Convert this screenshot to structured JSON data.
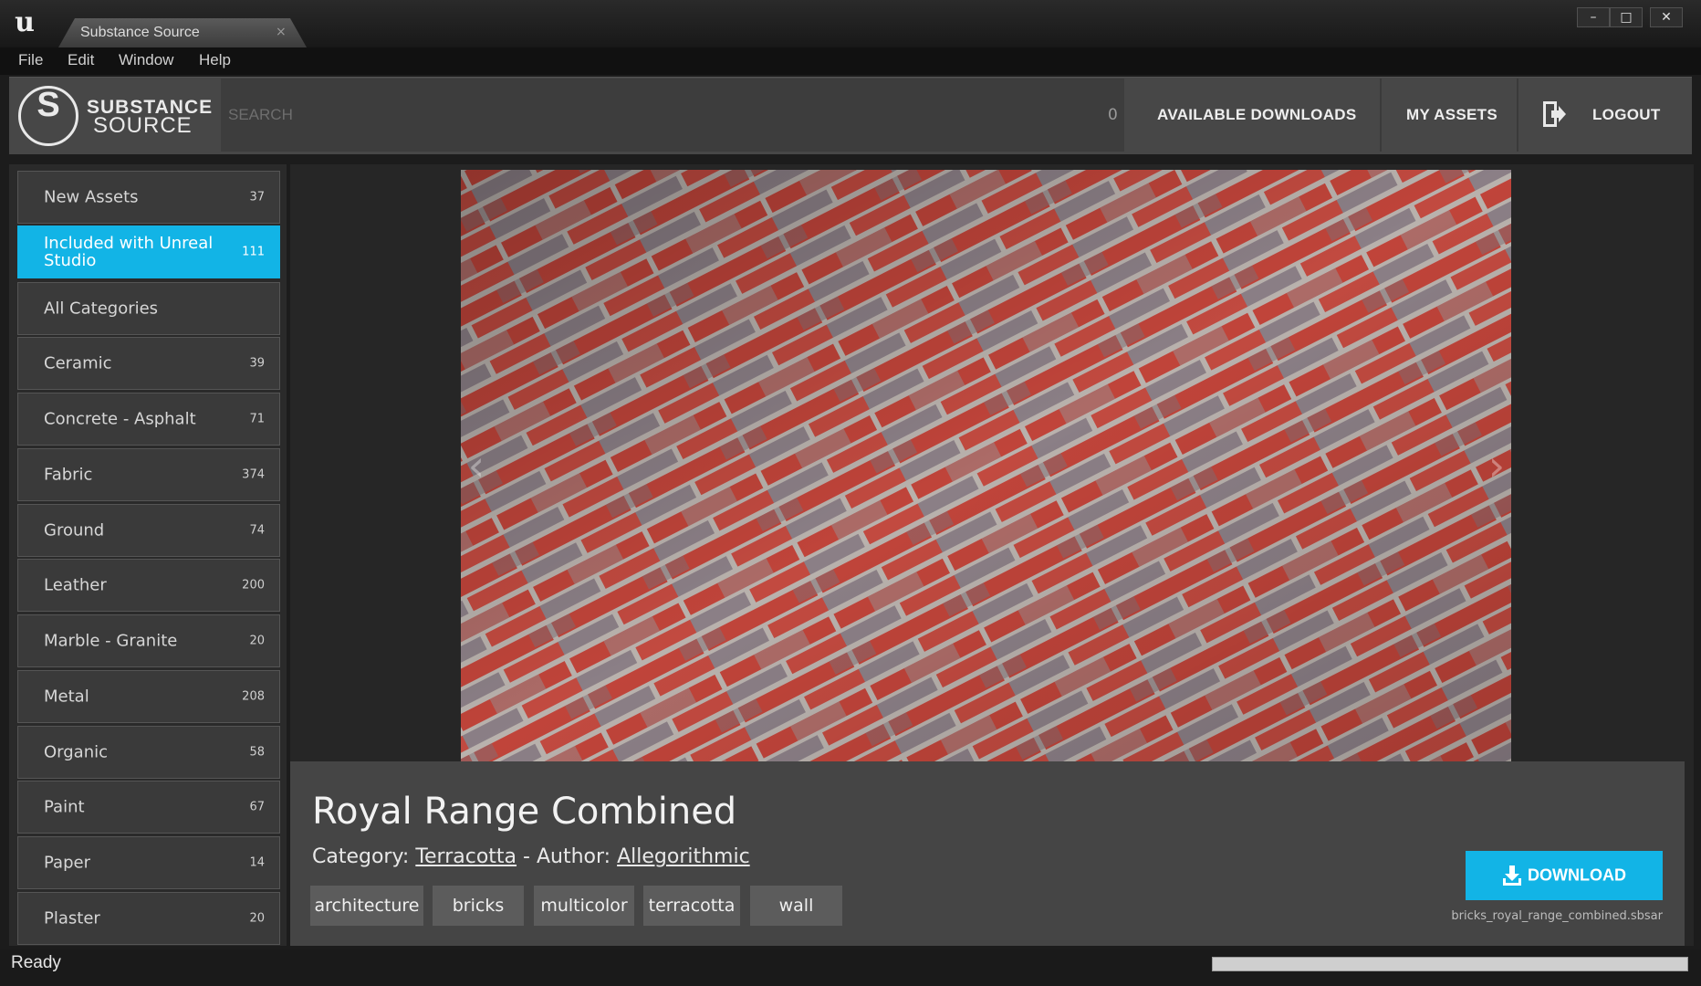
{
  "window": {
    "tab_title": "Substance Source",
    "tab_close": "×",
    "controls": {
      "minimize": "–",
      "maximize": "□",
      "close": "✕"
    }
  },
  "menu": [
    "File",
    "Edit",
    "Window",
    "Help"
  ],
  "header": {
    "brand_line1": "SUBSTANCE",
    "brand_line2": "SOURCE",
    "logo_letter": "S",
    "search_placeholder": "SEARCH",
    "download_count": "0",
    "available_downloads": "AVAILABLE DOWNLOADS",
    "my_assets": "MY ASSETS",
    "logout": "LOGOUT"
  },
  "sidebar": {
    "items": [
      {
        "label": "New Assets",
        "count": "37",
        "active": false
      },
      {
        "label": "Included with Unreal Studio",
        "count": "111",
        "active": true
      },
      {
        "label": "All Categories",
        "count": "",
        "active": false
      },
      {
        "label": "Ceramic",
        "count": "39",
        "active": false
      },
      {
        "label": "Concrete - Asphalt",
        "count": "71",
        "active": false
      },
      {
        "label": "Fabric",
        "count": "374",
        "active": false
      },
      {
        "label": "Ground",
        "count": "74",
        "active": false
      },
      {
        "label": "Leather",
        "count": "200",
        "active": false
      },
      {
        "label": "Marble - Granite",
        "count": "20",
        "active": false
      },
      {
        "label": "Metal",
        "count": "208",
        "active": false
      },
      {
        "label": "Organic",
        "count": "58",
        "active": false
      },
      {
        "label": "Paint",
        "count": "67",
        "active": false
      },
      {
        "label": "Paper",
        "count": "14",
        "active": false
      },
      {
        "label": "Plaster",
        "count": "20",
        "active": false
      }
    ]
  },
  "asset": {
    "title": "Royal Range Combined",
    "category_label": "Category:",
    "category": "Terracotta",
    "separator": "-",
    "author_label": "Author:",
    "author": "Allegorithmic",
    "tags": [
      "architecture",
      "bricks",
      "multicolor",
      "terracotta",
      "wall"
    ],
    "download_label": "DOWNLOAD",
    "filename": "bricks_royal_range_combined.sbsar"
  },
  "preview": {
    "prev_arrow": "‹",
    "next_arrow": "›"
  },
  "status": {
    "text": "Ready"
  },
  "colors": {
    "accent": "#12b4e6",
    "panel": "#454545",
    "background": "#262626"
  }
}
